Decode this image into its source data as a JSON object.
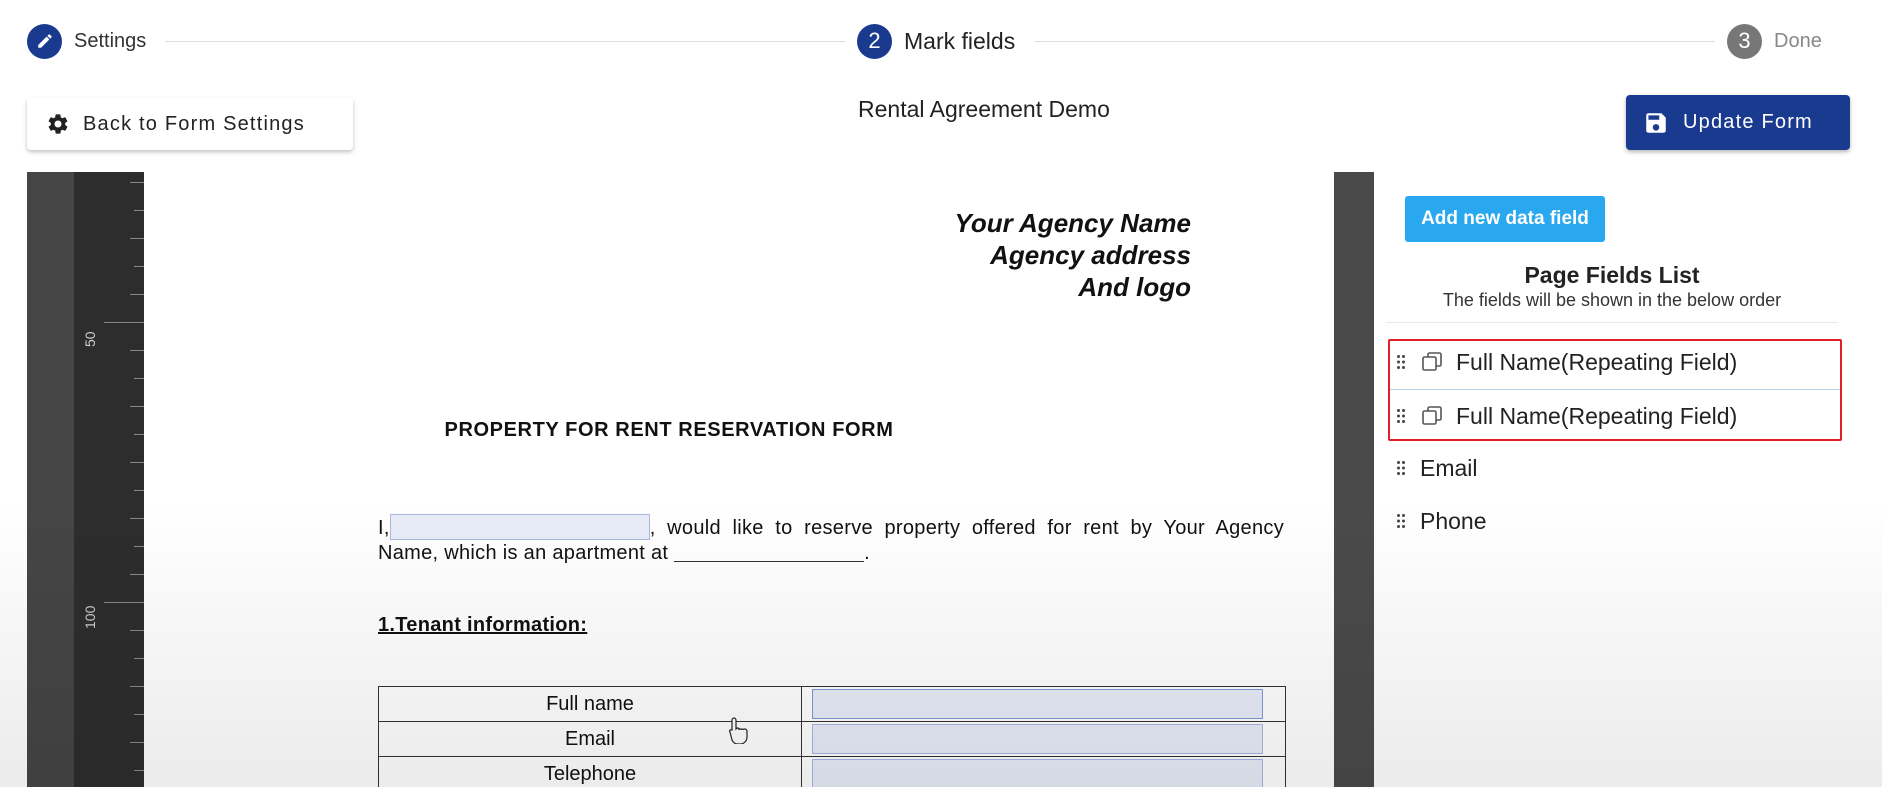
{
  "stepper": {
    "steps": [
      {
        "number": "",
        "label": "Settings"
      },
      {
        "number": "2",
        "label": "Mark fields"
      },
      {
        "number": "3",
        "label": "Done"
      }
    ]
  },
  "header": {
    "back_label": "Back to Form Settings",
    "title": "Rental Agreement Demo",
    "update_label": "Update Form"
  },
  "ruler": {
    "labels": [
      "50",
      "100"
    ]
  },
  "document": {
    "agency_lines": [
      "Your Agency Name",
      "Agency address",
      "And logo"
    ],
    "form_title": "PROPERTY FOR RENT RESERVATION FORM",
    "para_prefix": "I,",
    "para_middle": ", would like to reserve property offered for rent by Your Agency Name, which is an apartment at",
    "para_suffix": ".",
    "section_title": "1.Tenant information:",
    "table_rows": [
      "Full name",
      "Email",
      "Telephone"
    ]
  },
  "panel": {
    "add_button": "Add new data field",
    "list_title": "Page Fields List",
    "list_subtitle": "The fields will be shown in the below order",
    "fields": [
      {
        "label": "Full Name(Repeating Field)",
        "repeating": true
      },
      {
        "label": "Full Name(Repeating Field)",
        "repeating": true
      },
      {
        "label": "Email",
        "repeating": false
      },
      {
        "label": "Phone",
        "repeating": false
      }
    ]
  },
  "colors": {
    "primary": "#1a3a8f",
    "accent": "#29a8ef",
    "highlight": "#e01f2a",
    "field_fill": "#e8ecf8"
  }
}
